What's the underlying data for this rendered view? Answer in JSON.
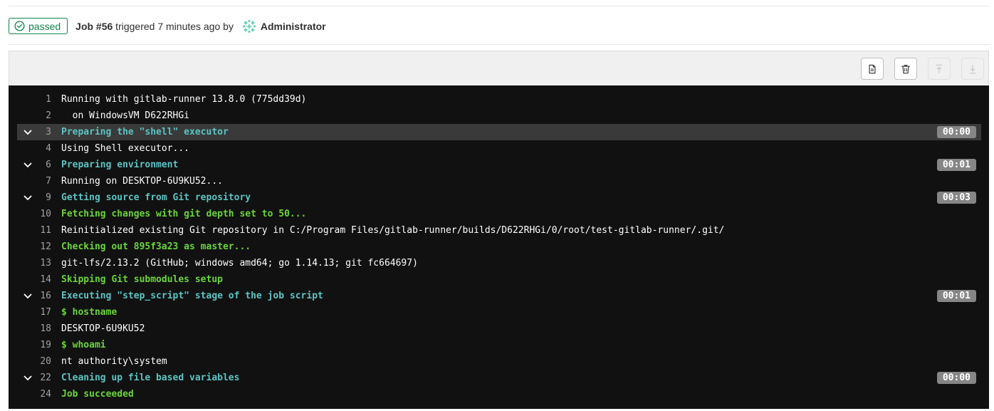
{
  "header": {
    "status": "passed",
    "job_id": "Job #56",
    "triggered": " triggered 7 minutes ago by ",
    "user": "Administrator"
  },
  "toolbar": {
    "buttons": [
      "raw-log",
      "erase-log",
      "scroll-to-top",
      "scroll-to-bottom"
    ]
  },
  "log": {
    "lines": [
      {
        "n": "1",
        "text": "Running with gitlab-runner 13.8.0 (775dd39d)",
        "style": "plain"
      },
      {
        "n": "2",
        "text": "  on WindowsVM D622RHGi",
        "style": "plain"
      },
      {
        "n": "3",
        "text": "Preparing the \"shell\" executor",
        "style": "section",
        "duration": "00:00",
        "collapsible": true,
        "highlight": true
      },
      {
        "n": "4",
        "text": "Using Shell executor...",
        "style": "plain"
      },
      {
        "n": "6",
        "text": "Preparing environment",
        "style": "section",
        "duration": "00:01",
        "collapsible": true
      },
      {
        "n": "7",
        "text": "Running on DESKTOP-6U9KU52...",
        "style": "plain"
      },
      {
        "n": "9",
        "text": "Getting source from Git repository",
        "style": "section",
        "duration": "00:03",
        "collapsible": true
      },
      {
        "n": "10",
        "text": "Fetching changes with git depth set to 50...",
        "style": "green"
      },
      {
        "n": "11",
        "text": "Reinitialized existing Git repository in C:/Program Files/gitlab-runner/builds/D622RHGi/0/root/test-gitlab-runner/.git/",
        "style": "plain"
      },
      {
        "n": "12",
        "text": "Checking out 895f3a23 as master...",
        "style": "green"
      },
      {
        "n": "13",
        "text": "git-lfs/2.13.2 (GitHub; windows amd64; go 1.14.13; git fc664697)",
        "style": "plain"
      },
      {
        "n": "14",
        "text": "Skipping Git submodules setup",
        "style": "green"
      },
      {
        "n": "16",
        "text": "Executing \"step_script\" stage of the job script",
        "style": "section",
        "duration": "00:01",
        "collapsible": true
      },
      {
        "n": "17",
        "text": "$ hostname",
        "style": "green"
      },
      {
        "n": "18",
        "text": "DESKTOP-6U9KU52",
        "style": "plain"
      },
      {
        "n": "19",
        "text": "$ whoami",
        "style": "green"
      },
      {
        "n": "20",
        "text": "nt authority\\system",
        "style": "plain"
      },
      {
        "n": "22",
        "text": "Cleaning up file based variables",
        "style": "section",
        "duration": "00:00",
        "collapsible": true
      },
      {
        "n": "24",
        "text": "Job succeeded",
        "style": "green"
      }
    ]
  },
  "colors": {
    "success": "#108548",
    "log_background": "#111111",
    "section_text": "#5ac4c4",
    "green_text": "#6ad53a",
    "duration_badge": "#868686"
  }
}
